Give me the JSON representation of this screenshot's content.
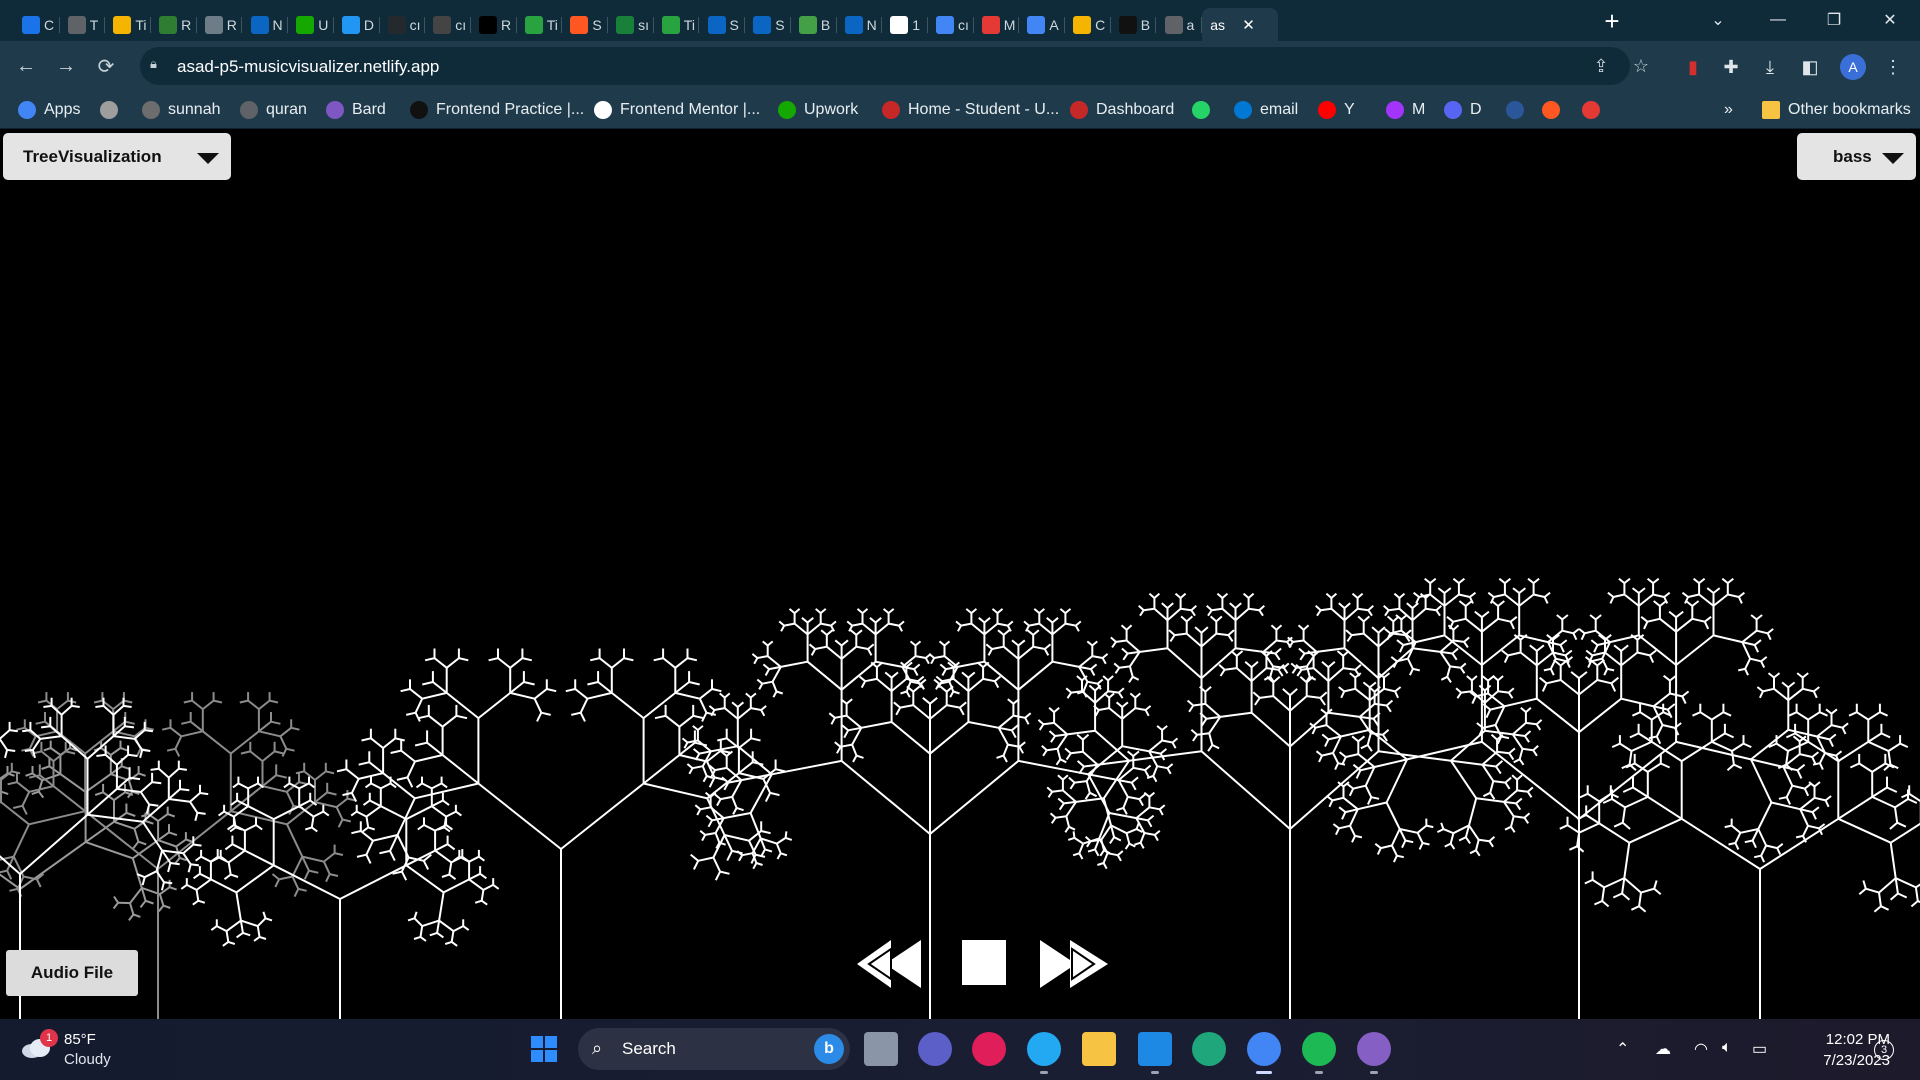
{
  "browser": {
    "tabs": [
      {
        "icon": "c",
        "label": "C",
        "color": "#1a73e8"
      },
      {
        "icon": "globe",
        "label": "T",
        "color": "#5f6368"
      },
      {
        "icon": "pinwheel",
        "label": "Ti",
        "color": "#f4b400"
      },
      {
        "icon": "w",
        "label": "R",
        "color": "#2e7d32"
      },
      {
        "icon": "chatgpt",
        "label": "R",
        "color": "#6e7c87"
      },
      {
        "icon": "in",
        "label": "N",
        "color": "#0a66c2"
      },
      {
        "icon": "up",
        "label": "U",
        "color": "#14a800"
      },
      {
        "icon": "y",
        "label": "D",
        "color": "#2196f3"
      },
      {
        "icon": "github",
        "label": "cı",
        "color": "#24292e"
      },
      {
        "icon": "square",
        "label": "cı",
        "color": "#444"
      },
      {
        "icon": "square-dark",
        "label": "R",
        "color": "#000"
      },
      {
        "icon": "px",
        "label": "Ti",
        "color": "#29a33f"
      },
      {
        "icon": "bolt",
        "label": "S",
        "color": "#ff5722"
      },
      {
        "icon": "drive",
        "label": "sı",
        "color": "#188038"
      },
      {
        "icon": "px",
        "label": "Ti",
        "color": "#29a33f"
      },
      {
        "icon": "in",
        "label": "S",
        "color": "#0a66c2"
      },
      {
        "icon": "in",
        "label": "S",
        "color": "#0a66c2"
      },
      {
        "icon": "b",
        "label": "B",
        "color": "#43a047"
      },
      {
        "icon": "in",
        "label": "N",
        "color": "#0a66c2"
      },
      {
        "icon": "g",
        "label": "1",
        "color": "#ffffff"
      },
      {
        "icon": "docs",
        "label": "cı",
        "color": "#4285f4"
      },
      {
        "icon": "pinwheel",
        "label": "M",
        "color": "#e53935"
      },
      {
        "icon": "docs",
        "label": "A",
        "color": "#4285f4"
      },
      {
        "icon": "slides",
        "label": "C",
        "color": "#f4b400"
      },
      {
        "icon": "dark",
        "label": "B",
        "color": "#111"
      },
      {
        "icon": "globe",
        "label": "a",
        "color": "#5f6368"
      }
    ],
    "active_tab": {
      "label": "as",
      "close": "✕"
    },
    "new_tab": "+",
    "window_controls": {
      "minimize": "—",
      "restore": "❐",
      "close": "✕",
      "tab_search": "⌄"
    },
    "url": "asad-p5-musicvisualizer.netlify.app",
    "bookmarks": [
      {
        "icon": "apps-grid-icon",
        "label": "Apps",
        "color": "#4285f4"
      },
      {
        "icon": "islamic-icon",
        "label": "",
        "color": "#9e9e9e"
      },
      {
        "icon": "sunnah-icon",
        "label": "sunnah",
        "color": "#6d6d6d"
      },
      {
        "icon": "globe-icon",
        "label": "quran",
        "color": "#5f6368"
      },
      {
        "icon": "bard-icon",
        "label": "Bard",
        "color": "#7e57c2"
      },
      {
        "icon": "fp-icon",
        "label": "Frontend Practice |...",
        "color": "#111111"
      },
      {
        "icon": "fm-icon",
        "label": "Frontend Mentor |...",
        "color": "#ffffff"
      },
      {
        "icon": "upwork-icon",
        "label": "Upwork",
        "color": "#14a800"
      },
      {
        "icon": "school-icon",
        "label": "Home - Student - U...",
        "color": "#c62828"
      },
      {
        "icon": "school-icon",
        "label": "Dashboard",
        "color": "#c62828"
      },
      {
        "icon": "whatsapp-icon",
        "label": "",
        "color": "#25d366"
      },
      {
        "icon": "outlook-icon",
        "label": "email",
        "color": "#0078d4"
      },
      {
        "icon": "youtube-icon",
        "label": "Y",
        "color": "#ff0000"
      },
      {
        "icon": "messenger-icon",
        "label": "M",
        "color": "#a334fa"
      },
      {
        "icon": "discord-icon",
        "label": "D",
        "color": "#5865f2"
      },
      {
        "icon": "ms-icon",
        "label": "",
        "color": "#2b579a"
      },
      {
        "icon": "bolt-icon",
        "label": "",
        "color": "#ff5722"
      },
      {
        "icon": "pinwheel-icon",
        "label": "",
        "color": "#e53935"
      }
    ],
    "bookmarks_more": "»",
    "other_bookmarks": "Other bookmarks",
    "avatar_letter": "A"
  },
  "app": {
    "visualization_select": "TreeVisualization",
    "band_select": "bass",
    "audio_button": "Audio File",
    "controls": {
      "rewind": "rewind",
      "stop": "stop",
      "forward": "fast-forward"
    }
  },
  "taskbar": {
    "weather": {
      "temp": "85°F",
      "condition": "Cloudy",
      "badge": "1"
    },
    "search_label": "Search",
    "apps": [
      {
        "name": "windows-start",
        "color": "#2f8cff",
        "running": false
      },
      {
        "name": "task-view",
        "color": "#8a96a8",
        "running": false
      },
      {
        "name": "teams-chat",
        "color": "#5b5fc7",
        "running": false
      },
      {
        "name": "slack",
        "color": "#e01e5a",
        "running": false
      },
      {
        "name": "vscode",
        "color": "#23a9f2",
        "running": true
      },
      {
        "name": "file-explorer",
        "color": "#f6c343",
        "running": false
      },
      {
        "name": "mail",
        "color": "#1e88e5",
        "running": true
      },
      {
        "name": "edge",
        "color": "#1fa67a",
        "running": false
      },
      {
        "name": "chrome",
        "color": "#4285f4",
        "running": true
      },
      {
        "name": "spotify",
        "color": "#1db954",
        "running": true
      },
      {
        "name": "visual-studio",
        "color": "#865fc5",
        "running": true
      }
    ],
    "time": "12:02 PM",
    "date": "7/23/2023",
    "notifications": "3"
  }
}
